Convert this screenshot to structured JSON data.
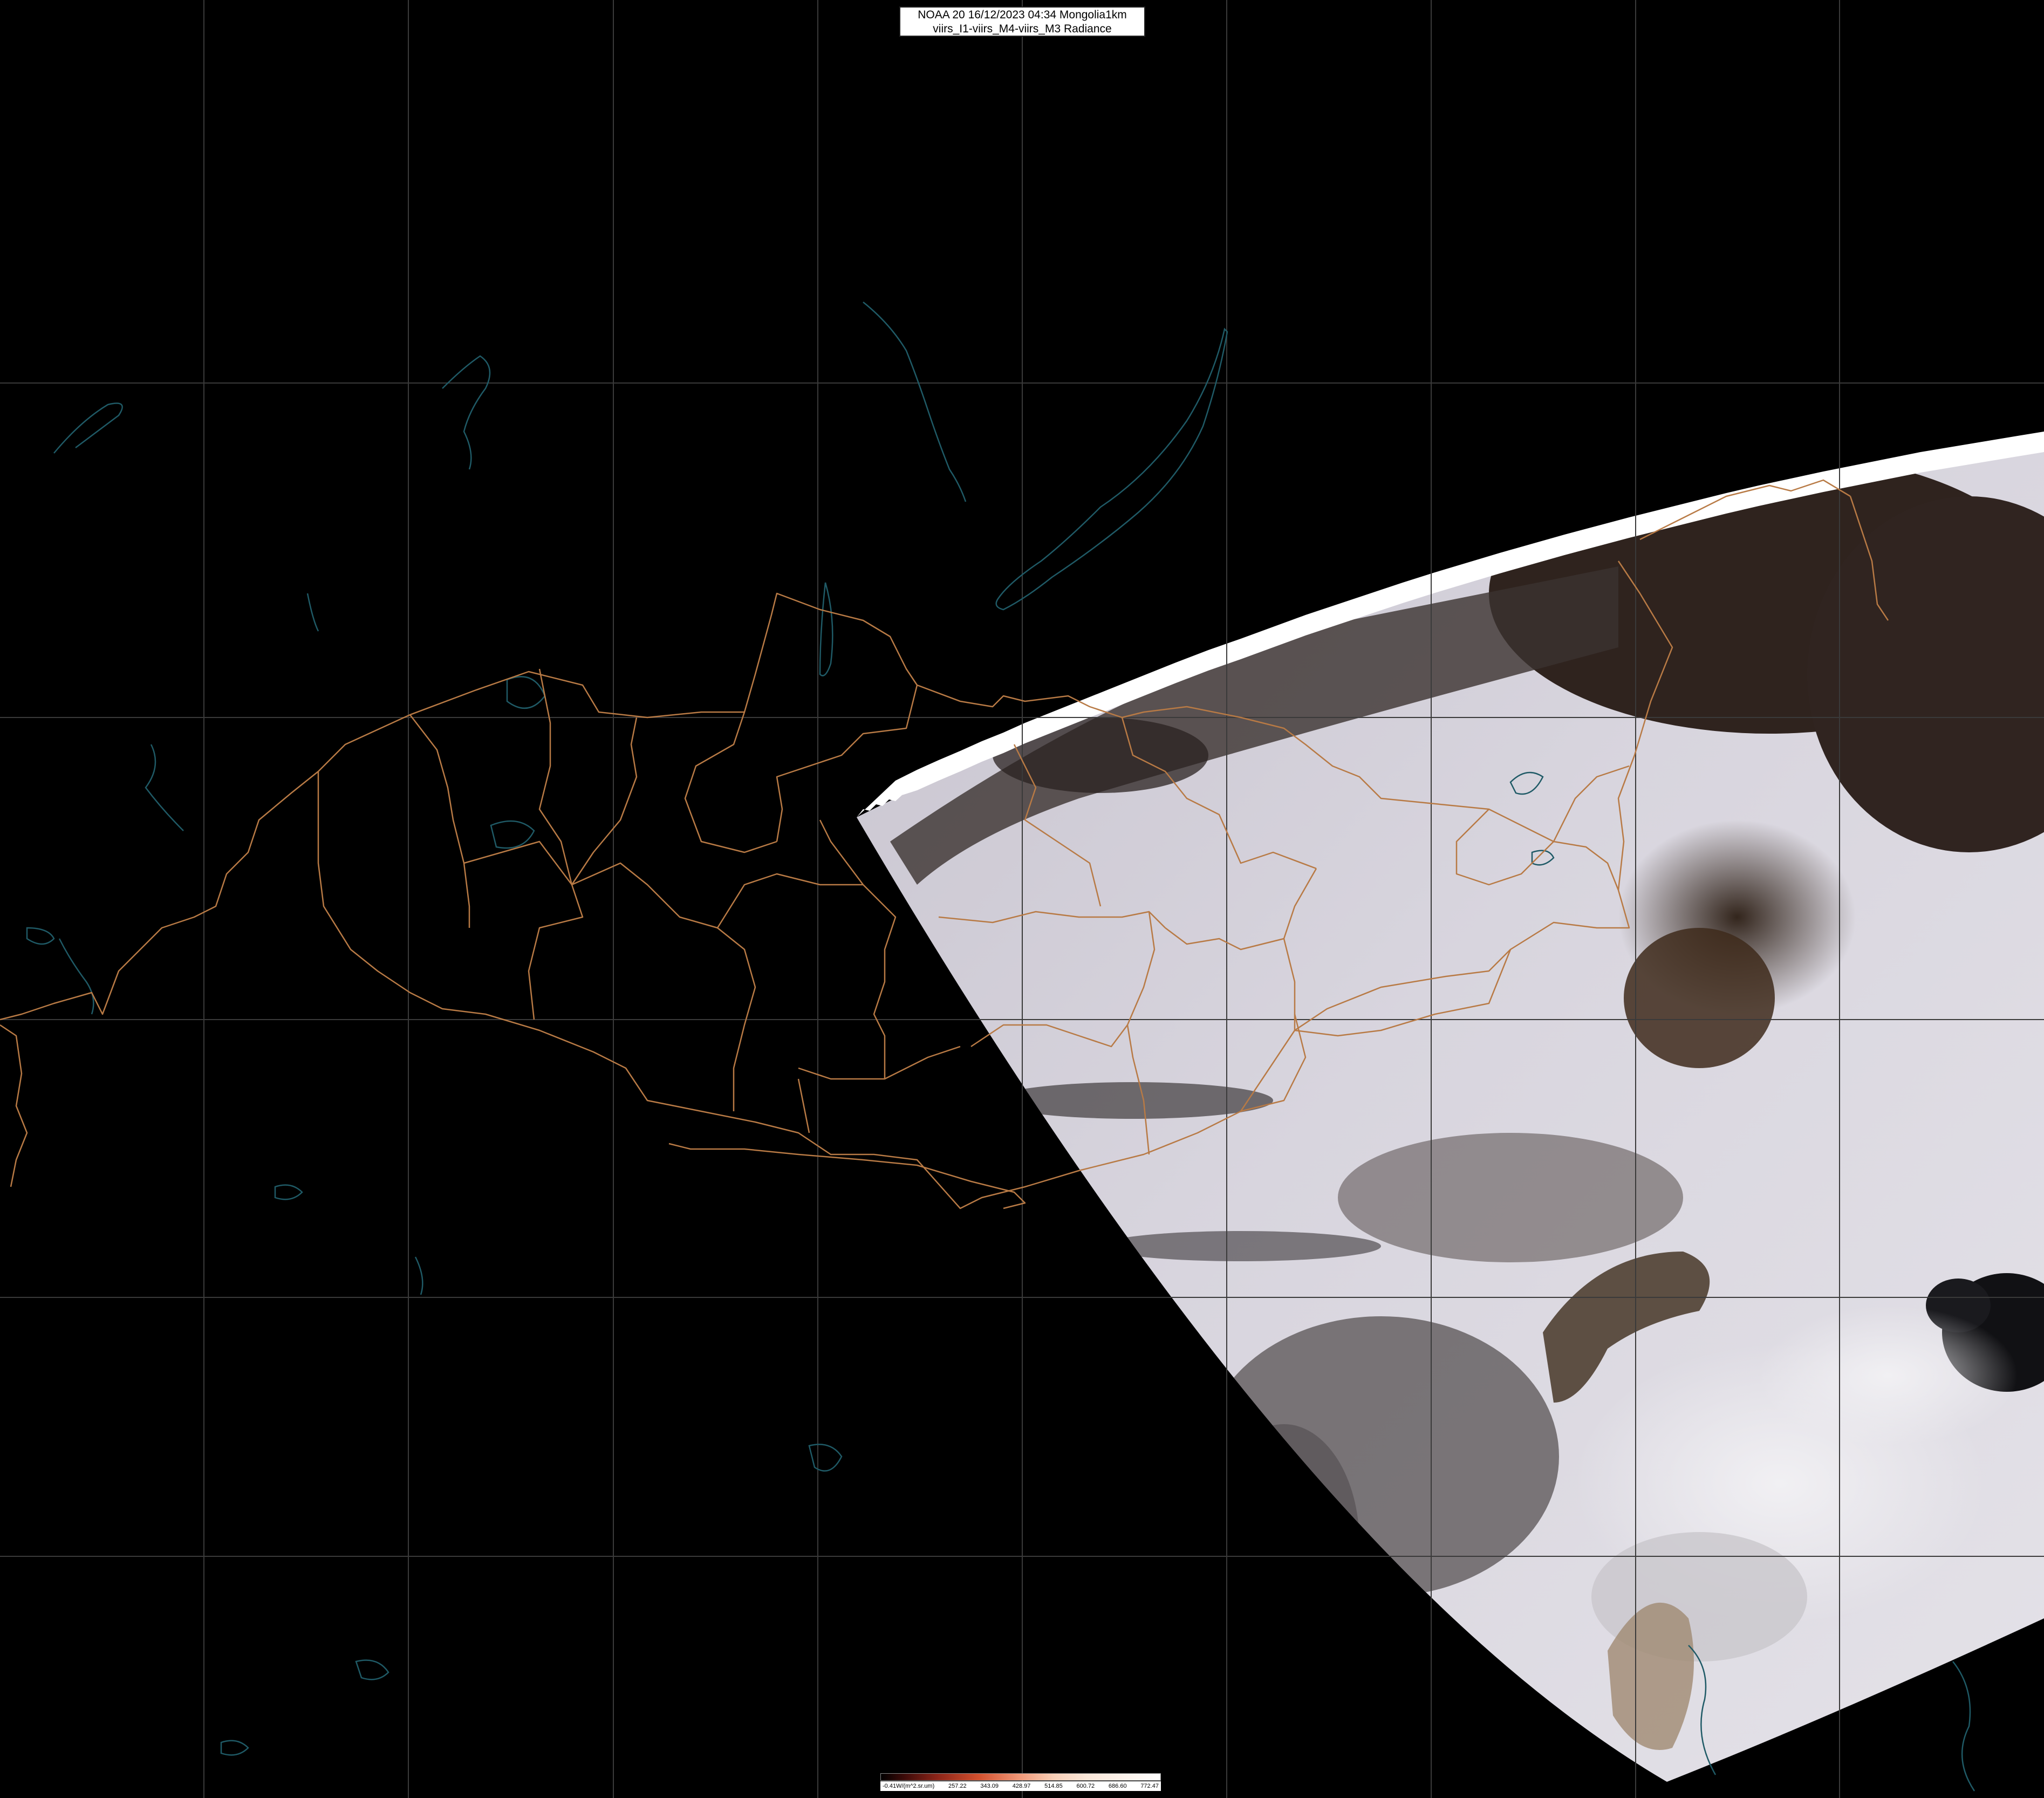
{
  "header": {
    "title_line1": "NOAA 20 16/12/2023 04:34 Mongolia1km",
    "title_line2": "viirs_I1-viirs_M4-viirs_M3 Radiance"
  },
  "colorbar": {
    "unit_label": "-0.41W/(m^2.sr.um)",
    "ticks": [
      "257.22",
      "343.09",
      "428.97",
      "514.85",
      "600.72",
      "686.60",
      "772.47"
    ]
  },
  "colors": {
    "background": "#000000",
    "graticule": "#3a3a3a",
    "admin_border": "#b87a45",
    "water": "#1f5a66",
    "snow": "#d9d6de",
    "forest": "#3a2b25"
  }
}
